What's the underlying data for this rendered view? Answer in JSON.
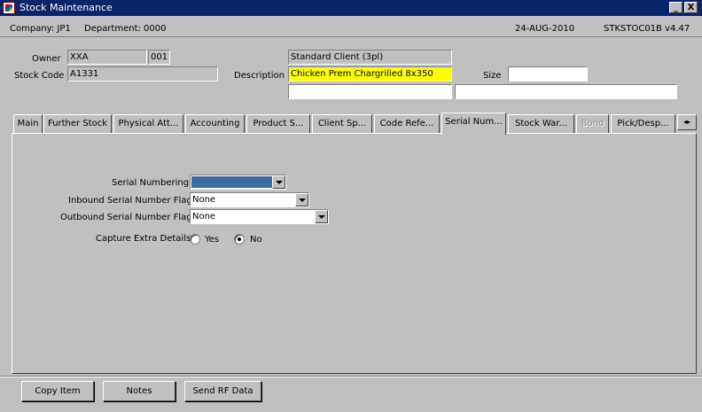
{
  "window": {
    "title": "Stock Maintenance",
    "minimize_label": "_",
    "close_label": "X"
  },
  "info": {
    "company": "Company:  JP1",
    "department": "Department:  0000",
    "date": "24-AUG-2010",
    "program": "STKSTOC01B  v4.47"
  },
  "header": {
    "owner_label": "Owner",
    "owner_value": "XXA",
    "owner_code": "001",
    "client_name": "Standard Client (3pl)",
    "stock_code_label": "Stock Code",
    "stock_code_value": "A1331",
    "description_label": "Description",
    "description_value": "Chicken Prem Chargrilled 8x350",
    "description_line2": "",
    "description_line3": "",
    "size_label": "Size",
    "size_value": ""
  },
  "tabs": [
    {
      "label": "Main"
    },
    {
      "label": "Further Stock"
    },
    {
      "label": "Physical Att..."
    },
    {
      "label": "Accounting"
    },
    {
      "label": "Product S..."
    },
    {
      "label": "Client Sp..."
    },
    {
      "label": "Code Refe..."
    },
    {
      "label": "Serial Num..."
    },
    {
      "label": "Stock War..."
    },
    {
      "label": "Bond"
    },
    {
      "label": "Pick/Desp..."
    }
  ],
  "tab_scroll_label": "◂▸",
  "serial": {
    "serial_numbering_label": "Serial Numbering",
    "serial_numbering_value": "",
    "inbound_label": "Inbound Serial Number Flag",
    "inbound_value": "None",
    "outbound_label": "Outbound Serial Number Flag",
    "outbound_value": "None",
    "capture_label": "Capture Extra Details",
    "capture_options": [
      "Yes",
      "No"
    ],
    "capture_selected": "No"
  },
  "buttons": {
    "copy_item": "Copy Item",
    "notes": "Notes",
    "send_rf": "Send RF Data"
  },
  "colors": {
    "titlebar": "#0a246a",
    "highlight_field": "#ffff00",
    "selection": "#3a6ea5"
  }
}
